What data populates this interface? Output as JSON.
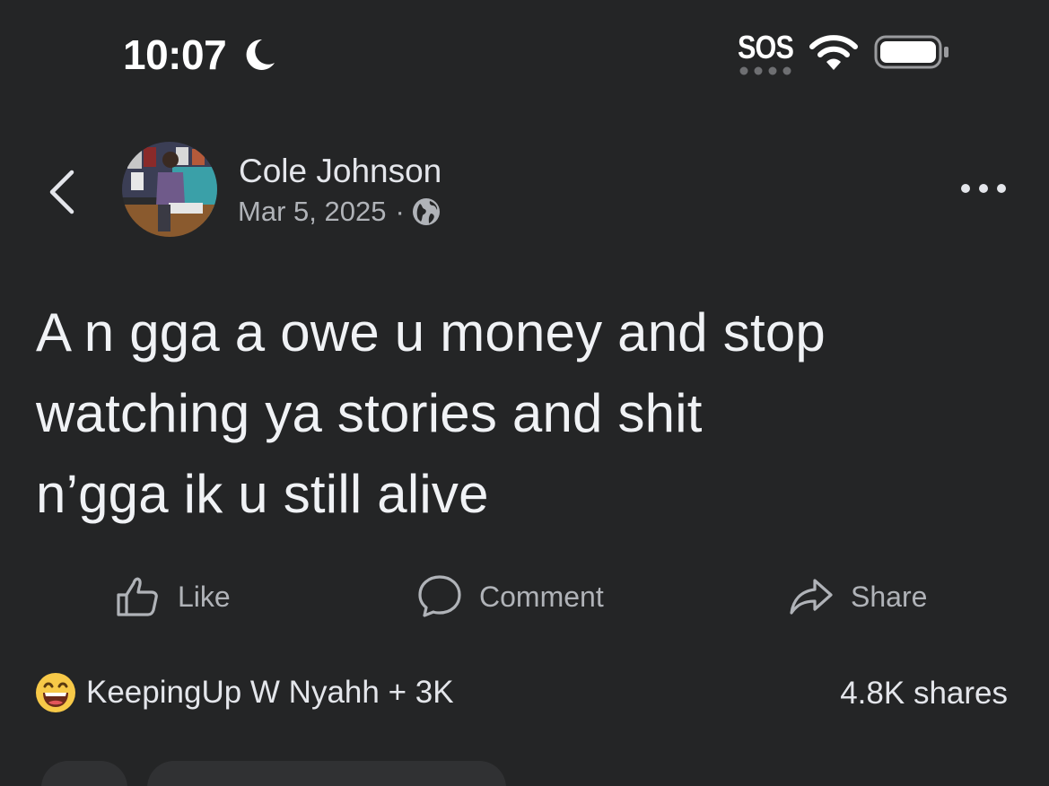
{
  "status_bar": {
    "time": "10:07",
    "carrier": "SOS",
    "icons": [
      "moon-icon",
      "wifi-icon",
      "battery-icon"
    ]
  },
  "header": {
    "author_name": "Cole Johnson",
    "date": "Mar 5, 2025",
    "separator": "·",
    "privacy_icon": "globe-icon"
  },
  "post": {
    "lines": [
      "A n gga a owe u money and stop",
      "watching ya stories and shit",
      "n’gga ik u still alive"
    ]
  },
  "actions": {
    "like": "Like",
    "comment": "Comment",
    "share": "Share"
  },
  "engagement": {
    "reaction_icon": "grinning-face-emoji",
    "reaction_text": "KeepingUp W Nyahh + 3K",
    "shares": "4.8K shares"
  },
  "colors": {
    "background": "#242526",
    "primary_text": "#e4e6eb",
    "secondary_text": "#b0b3b8"
  }
}
